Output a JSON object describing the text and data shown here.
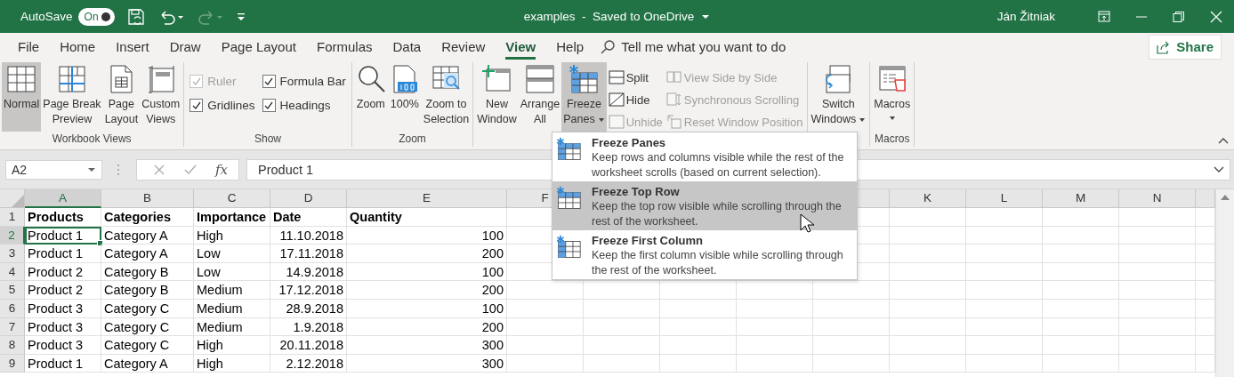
{
  "title_bar": {
    "autosave_label": "AutoSave",
    "autosave_toggle": {
      "label": "On",
      "on": true
    },
    "redo_disabled": true,
    "document_title": "examples  -  Saved to OneDrive",
    "user": "Ján Žitniak"
  },
  "ribbon_tabs": [
    {
      "label": "File",
      "selected": false
    },
    {
      "label": "Home",
      "selected": false
    },
    {
      "label": "Insert",
      "selected": false
    },
    {
      "label": "Draw",
      "selected": false
    },
    {
      "label": "Page Layout",
      "selected": false
    },
    {
      "label": "Formulas",
      "selected": false
    },
    {
      "label": "Data",
      "selected": false
    },
    {
      "label": "Review",
      "selected": false
    },
    {
      "label": "View",
      "selected": true
    },
    {
      "label": "Help",
      "selected": false
    }
  ],
  "tell_me": {
    "placeholder": "Tell me what you want to do"
  },
  "share_button": "Share",
  "ribbon_groups": [
    {
      "label": "Workbook Views",
      "blocks": [
        {
          "kind": "large",
          "lines": [
            "Normal"
          ],
          "selected": true,
          "dropdown": false
        },
        {
          "kind": "large",
          "lines": [
            "Page Break",
            "Preview"
          ],
          "selected": false,
          "dropdown": false
        },
        {
          "kind": "large",
          "lines": [
            "Page",
            "Layout"
          ],
          "selected": false,
          "dropdown": false
        },
        {
          "kind": "large",
          "lines": [
            "Custom",
            "Views"
          ],
          "selected": false,
          "dropdown": false
        }
      ]
    },
    {
      "label": "Show",
      "blocks": [
        {
          "kind": "checks",
          "items": [
            {
              "label": "Ruler",
              "checked": true,
              "disabled": true
            },
            {
              "label": "Formula Bar",
              "checked": true,
              "disabled": false
            },
            {
              "label": "Gridlines",
              "checked": true,
              "disabled": false
            },
            {
              "label": "Headings",
              "checked": true,
              "disabled": false
            }
          ]
        }
      ]
    },
    {
      "label": "Zoom",
      "blocks": [
        {
          "kind": "large",
          "lines": [
            "Zoom"
          ],
          "selected": false,
          "dropdown": false
        },
        {
          "kind": "large",
          "lines": [
            "100%"
          ],
          "selected": false,
          "dropdown": false
        },
        {
          "kind": "large",
          "lines": [
            "Zoom to",
            "Selection"
          ],
          "selected": false,
          "dropdown": false
        }
      ]
    },
    {
      "blocks": [
        {
          "kind": "large",
          "lines": [
            "New",
            "Window"
          ],
          "selected": false,
          "dropdown": false
        },
        {
          "kind": "large",
          "lines": [
            "Arrange",
            "All"
          ],
          "selected": false,
          "dropdown": false
        },
        {
          "kind": "large",
          "lines": [
            "Freeze",
            "Panes"
          ],
          "selected": true,
          "dropdown": true
        },
        {
          "kind": "small",
          "items": [
            {
              "label": "Split",
              "disabled": false
            },
            {
              "label": "Hide",
              "disabled": false
            },
            {
              "label": "Unhide",
              "disabled": true
            }
          ]
        },
        {
          "kind": "small",
          "items": [
            {
              "label": "View Side by Side",
              "disabled": true
            },
            {
              "label": "Synchronous Scrolling",
              "disabled": true
            },
            {
              "label": "Reset Window Position",
              "disabled": true
            }
          ]
        },
        {
          "kind": "large",
          "lines": [
            "Switch",
            "Windows"
          ],
          "selected": false,
          "dropdown": true
        }
      ]
    },
    {
      "label": "Macros",
      "blocks": [
        {
          "kind": "large",
          "lines": [
            "Macros"
          ],
          "selected": false,
          "dropdown": true
        }
      ]
    }
  ],
  "formula_bar": {
    "name_box": "A2",
    "fx": "fx",
    "formula": "Product 1"
  },
  "sheet": {
    "columns_left": [
      {
        "label": "A",
        "selected": true
      },
      {
        "label": "B",
        "selected": false
      },
      {
        "label": "C",
        "selected": false
      },
      {
        "label": "D",
        "selected": false
      },
      {
        "label": "E",
        "selected": false
      },
      {
        "label": "F",
        "selected": false
      }
    ],
    "columns_right": [
      {
        "label": "K",
        "selected": false
      },
      {
        "label": "L",
        "selected": false
      },
      {
        "label": "M",
        "selected": false
      },
      {
        "label": "N",
        "selected": false
      }
    ],
    "rows": [
      {
        "header": "1",
        "selected": false,
        "bold": true,
        "cells": [
          {
            "text": "Products",
            "kind": "text"
          },
          {
            "text": "Categories",
            "kind": "text"
          },
          {
            "text": "Importance",
            "kind": "text"
          },
          {
            "text": "Date",
            "kind": "text"
          },
          {
            "text": "Quantity",
            "kind": "text"
          }
        ]
      },
      {
        "header": "2",
        "selected": true,
        "bold": false,
        "cells": [
          {
            "text": "Product 1",
            "kind": "text"
          },
          {
            "text": "Category A",
            "kind": "text"
          },
          {
            "text": "High",
            "kind": "text"
          },
          {
            "text": "11.10.2018",
            "kind": "number"
          },
          {
            "text": "100",
            "kind": "number"
          }
        ]
      },
      {
        "header": "3",
        "selected": false,
        "bold": false,
        "cells": [
          {
            "text": "Product 1",
            "kind": "text"
          },
          {
            "text": "Category A",
            "kind": "text"
          },
          {
            "text": "Low",
            "kind": "text"
          },
          {
            "text": "17.11.2018",
            "kind": "number"
          },
          {
            "text": "200",
            "kind": "number"
          }
        ]
      },
      {
        "header": "4",
        "selected": false,
        "bold": false,
        "cells": [
          {
            "text": "Product 2",
            "kind": "text"
          },
          {
            "text": "Category B",
            "kind": "text"
          },
          {
            "text": "Low",
            "kind": "text"
          },
          {
            "text": "14.9.2018",
            "kind": "number"
          },
          {
            "text": "100",
            "kind": "number"
          }
        ]
      },
      {
        "header": "5",
        "selected": false,
        "bold": false,
        "cells": [
          {
            "text": "Product 2",
            "kind": "text"
          },
          {
            "text": "Category B",
            "kind": "text"
          },
          {
            "text": "Medium",
            "kind": "text"
          },
          {
            "text": "17.12.2018",
            "kind": "number"
          },
          {
            "text": "200",
            "kind": "number"
          }
        ]
      },
      {
        "header": "6",
        "selected": false,
        "bold": false,
        "cells": [
          {
            "text": "Product 3",
            "kind": "text"
          },
          {
            "text": "Category C",
            "kind": "text"
          },
          {
            "text": "Medium",
            "kind": "text"
          },
          {
            "text": "28.9.2018",
            "kind": "number"
          },
          {
            "text": "100",
            "kind": "number"
          }
        ]
      },
      {
        "header": "7",
        "selected": false,
        "bold": false,
        "cells": [
          {
            "text": "Product 3",
            "kind": "text"
          },
          {
            "text": "Category C",
            "kind": "text"
          },
          {
            "text": "Medium",
            "kind": "text"
          },
          {
            "text": "1.9.2018",
            "kind": "number"
          },
          {
            "text": "200",
            "kind": "number"
          }
        ]
      },
      {
        "header": "8",
        "selected": false,
        "bold": false,
        "cells": [
          {
            "text": "Product 3",
            "kind": "text"
          },
          {
            "text": "Category C",
            "kind": "text"
          },
          {
            "text": "High",
            "kind": "text"
          },
          {
            "text": "20.11.2018",
            "kind": "number"
          },
          {
            "text": "300",
            "kind": "number"
          }
        ]
      },
      {
        "header": "9",
        "selected": false,
        "bold": false,
        "cells": [
          {
            "text": "Product 1",
            "kind": "text"
          },
          {
            "text": "Category A",
            "kind": "text"
          },
          {
            "text": "High",
            "kind": "text"
          },
          {
            "text": "2.12.2018",
            "kind": "number"
          },
          {
            "text": "300",
            "kind": "number"
          }
        ]
      }
    ]
  },
  "freeze_menu": {
    "items": [
      {
        "title": "Freeze Panes",
        "description": "Keep rows and columns visible while the rest of the worksheet scrolls (based on current selection).",
        "selected": false
      },
      {
        "title": "Freeze Top Row",
        "description": "Keep the top row visible while scrolling through the rest of the worksheet.",
        "selected": true
      },
      {
        "title": "Freeze First Column",
        "description": "Keep the first column visible while scrolling through the rest of the worksheet.",
        "selected": false
      }
    ]
  }
}
